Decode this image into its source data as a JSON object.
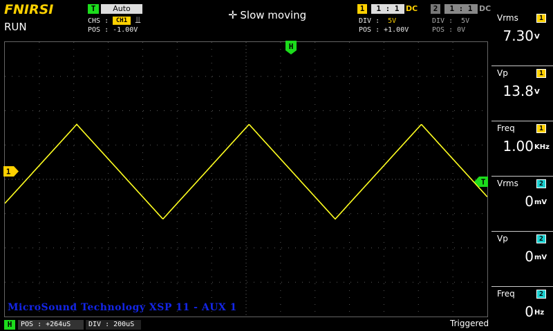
{
  "header": {
    "brand": "FNIRSI",
    "run_state": "RUN",
    "trigger_chip": "T",
    "trigger_mode": "Auto",
    "chs_label": "CHS :",
    "chs_channel": "CH1",
    "edge_symbol": "⫫",
    "trigger_pos_label": "POS : -1.00V",
    "move_icon": "✛",
    "move_text": "Slow moving"
  },
  "channels": [
    {
      "num": "1",
      "probe": "1 : 1",
      "coupling": "DC",
      "div_label": "DIV :",
      "div_value": "5V",
      "pos_label": "POS : +1.00V",
      "color": "#ffd100"
    },
    {
      "num": "2",
      "probe": "1 : 1",
      "coupling": "DC",
      "div_label": "DIV :",
      "div_value": "5V",
      "pos_label": "POS : 0V",
      "color": "#1bd0d0"
    }
  ],
  "markers": {
    "h": "H",
    "ch1": "1",
    "trigger": "T"
  },
  "waveform": {
    "type": "triangle",
    "color": "#ffff20",
    "frequency_khz": 1.0,
    "vpp_v": 13.8,
    "timebase_us_per_div": 200,
    "volts_per_div": 5
  },
  "watermark": "MicroSound Technology XSP 11 - AUX 1",
  "footer": {
    "h_badge": "H",
    "h_pos": "POS : +264uS",
    "h_div": "DIV : 200uS",
    "trigger_status": "Triggered"
  },
  "measurements": [
    {
      "label": "Vrms",
      "ch": "1",
      "value": "7.30",
      "unit": "V"
    },
    {
      "label": "Vp",
      "ch": "1",
      "value": "13.8",
      "unit": "V"
    },
    {
      "label": "Freq",
      "ch": "1",
      "value": "1.00",
      "unit": "KHz"
    },
    {
      "label": "Vrms",
      "ch": "2",
      "value": "0",
      "unit": "mV"
    },
    {
      "label": "Vp",
      "ch": "2",
      "value": "0",
      "unit": "mV"
    },
    {
      "label": "Freq",
      "ch": "2",
      "value": "0",
      "unit": "Hz"
    }
  ]
}
